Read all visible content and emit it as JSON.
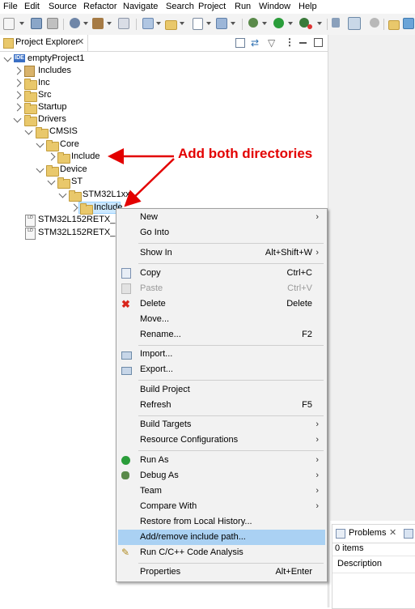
{
  "menubar": {
    "items": [
      "File",
      "Edit",
      "Source",
      "Refactor",
      "Navigate",
      "Search",
      "Project",
      "Run",
      "Window",
      "Help"
    ]
  },
  "project_explorer": {
    "tab_title": "Project Explorer",
    "tree": [
      {
        "label": "emptyProject1",
        "icon": "ide-project-icon",
        "state": "open"
      },
      {
        "label": "Includes",
        "icon": "includes-icon",
        "state": "closed"
      },
      {
        "label": "Inc",
        "icon": "folder-icon",
        "state": "closed"
      },
      {
        "label": "Src",
        "icon": "folder-icon",
        "state": "closed"
      },
      {
        "label": "Startup",
        "icon": "folder-icon",
        "state": "closed"
      },
      {
        "label": "Drivers",
        "icon": "folder-icon",
        "state": "open"
      },
      {
        "label": "CMSIS",
        "icon": "folder-icon",
        "state": "open"
      },
      {
        "label": "Core",
        "icon": "folder-icon",
        "state": "open"
      },
      {
        "label": "Include",
        "icon": "folder-icon",
        "state": "closed"
      },
      {
        "label": "Device",
        "icon": "folder-icon",
        "state": "open"
      },
      {
        "label": "ST",
        "icon": "folder-icon",
        "state": "open"
      },
      {
        "label": "STM32L1xx",
        "icon": "folder-icon",
        "state": "open"
      },
      {
        "label": "Include",
        "icon": "folder-icon",
        "state": "closed"
      },
      {
        "label": "STM32L152RETX_FLA",
        "icon": "linker-file-icon",
        "state": "none"
      },
      {
        "label": "STM32L152RETX_RAM",
        "icon": "linker-file-icon",
        "state": "none"
      }
    ]
  },
  "context_menu": {
    "items": [
      {
        "label": "New",
        "shortcut": "",
        "submenu": true
      },
      {
        "label": "Go Into",
        "shortcut": "",
        "submenu": false
      },
      {
        "sep": true
      },
      {
        "label": "Show In",
        "shortcut": "Alt+Shift+W",
        "submenu": true
      },
      {
        "sep": true
      },
      {
        "label": "Copy",
        "shortcut": "Ctrl+C",
        "submenu": false,
        "icon": "copy-icon"
      },
      {
        "label": "Paste",
        "shortcut": "Ctrl+V",
        "submenu": false,
        "icon": "paste-icon",
        "disabled": true
      },
      {
        "label": "Delete",
        "shortcut": "Delete",
        "submenu": false,
        "icon": "delete-icon"
      },
      {
        "label": "Move...",
        "shortcut": "",
        "submenu": false
      },
      {
        "label": "Rename...",
        "shortcut": "F2",
        "submenu": false
      },
      {
        "sep": true
      },
      {
        "label": "Import...",
        "shortcut": "",
        "submenu": false,
        "icon": "import-icon"
      },
      {
        "label": "Export...",
        "shortcut": "",
        "submenu": false,
        "icon": "export-icon"
      },
      {
        "sep": true
      },
      {
        "label": "Build Project",
        "shortcut": "",
        "submenu": false
      },
      {
        "label": "Refresh",
        "shortcut": "F5",
        "submenu": false
      },
      {
        "sep": true
      },
      {
        "label": "Build Targets",
        "shortcut": "",
        "submenu": true
      },
      {
        "label": "Resource Configurations",
        "shortcut": "",
        "submenu": true
      },
      {
        "sep": true
      },
      {
        "label": "Run As",
        "shortcut": "",
        "submenu": true,
        "icon": "run-icon"
      },
      {
        "label": "Debug As",
        "shortcut": "",
        "submenu": true,
        "icon": "debug-icon"
      },
      {
        "label": "Team",
        "shortcut": "",
        "submenu": true
      },
      {
        "label": "Compare With",
        "shortcut": "",
        "submenu": true
      },
      {
        "label": "Restore from Local History...",
        "shortcut": "",
        "submenu": false
      },
      {
        "label": "Add/remove include path...",
        "shortcut": "",
        "submenu": false,
        "highlighted": true
      },
      {
        "label": "Run C/C++ Code Analysis",
        "shortcut": "",
        "submenu": false,
        "icon": "code-analysis-icon"
      },
      {
        "sep": true
      },
      {
        "label": "Properties",
        "shortcut": "Alt+Enter",
        "submenu": false
      }
    ]
  },
  "annotation": {
    "text": "Add both directories",
    "color": "#e30000"
  },
  "problems_panel": {
    "tab_title": "Problems",
    "count_text": "0 items",
    "column_header": "Description"
  },
  "colors": {
    "highlight": "#aad1f3",
    "menu_bg": "#f2f2f2",
    "selection": "#cce8ff"
  }
}
